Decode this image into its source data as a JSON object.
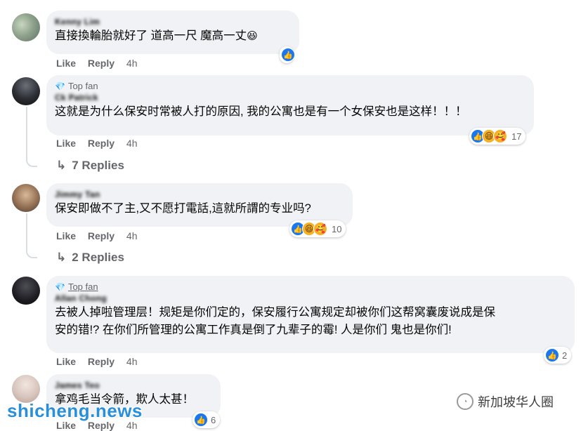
{
  "comments": [
    {
      "author": "Kenny Lim",
      "text": "直接換輪胎就好了 道高一尺 魔高一丈",
      "emoji": "😆",
      "like": "Like",
      "reply": "Reply",
      "time": "4h",
      "reaction_count": ""
    },
    {
      "badge": "Top fan",
      "author": "Ck Patrick",
      "text": "这就是为什么保安时常被人打的原因, 我的公寓也是有一个女保安也是这样！！！",
      "like": "Like",
      "reply": "Reply",
      "time": "4h",
      "reaction_count": "17",
      "replies": "7 Replies"
    },
    {
      "author": "Jimmy Tan",
      "text": "保安即做不了主,又不愿打電話,這就所謂的专业吗?",
      "like": "Like",
      "reply": "Reply",
      "time": "4h",
      "reaction_count": "10",
      "replies": "2 Replies"
    },
    {
      "badge": "Top fan",
      "author": "Allan Chong",
      "text_line1": "去被人掉啦管理层！规矩是你们定的，保安履行公寓规定却被你们这帮窝囊废说成是保",
      "text_line2": "安的错!? 在你们所管理的公寓工作真是倒了九辈子的霉! 人是你们 鬼也是你们!",
      "like": "Like",
      "reply": "Reply",
      "time": "4h",
      "reaction_count": "2"
    },
    {
      "author": "James Teo",
      "text": "拿鸡毛当令箭，欺人太甚！",
      "like": "Like",
      "reply": "Reply",
      "time": "4h",
      "reaction_count": "6"
    }
  ],
  "watermark": "shicheng.news",
  "wechat_label": "新加坡华人圈",
  "icons": [
    "like-icon",
    "haha-icon",
    "care-icon",
    "reply-arrow-icon",
    "diamond-icon",
    "wechat-icon"
  ],
  "colors": {
    "bubble": "#f0f2f5",
    "like": "#1877f2",
    "muted": "#65676b"
  }
}
